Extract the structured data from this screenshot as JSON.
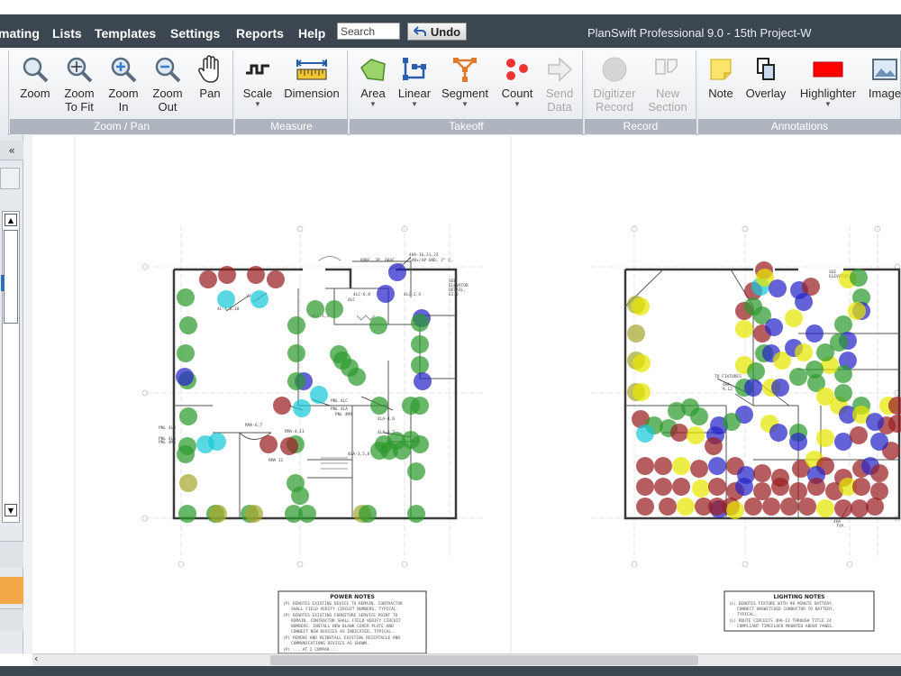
{
  "app_title": "PlanSwift Professional 9.0 - 15th Project-W",
  "menu": [
    "mating",
    "Lists",
    "Templates",
    "Settings",
    "Reports",
    "Help"
  ],
  "search": {
    "placeholder": "Search"
  },
  "undo_label": "Undo",
  "ribbon": {
    "groups": [
      "Zoom / Pan",
      "Measure",
      "Takeoff",
      "Record",
      "Annotations"
    ],
    "tools": {
      "zoom": [
        "Zoom",
        ""
      ],
      "zoom_to_fit": [
        "Zoom",
        "To Fit"
      ],
      "zoom_in": [
        "Zoom",
        "In"
      ],
      "zoom_out": [
        "Zoom",
        "Out"
      ],
      "pan": [
        "Pan",
        ""
      ],
      "scale": [
        "Scale",
        ""
      ],
      "dimension": [
        "Dimension",
        ""
      ],
      "area": [
        "Area",
        ""
      ],
      "linear": [
        "Linear",
        ""
      ],
      "segment": [
        "Segment",
        ""
      ],
      "count": [
        "Count",
        ""
      ],
      "send_data": [
        "Send",
        "Data"
      ],
      "digitizer_record": [
        "Digitizer",
        "Record"
      ],
      "new_section": [
        "New",
        "Section"
      ],
      "note": [
        "Note",
        ""
      ],
      "overlay": [
        "Overlay",
        ""
      ],
      "highlighter": [
        "Highlighter",
        ""
      ],
      "image": [
        "Image",
        ""
      ]
    }
  },
  "left_panel": {
    "collapse_glyph": "«"
  },
  "sheets": {
    "left_notes_title": "POWER NOTES",
    "right_notes_title": "LIGHTING NOTES"
  },
  "colors": {
    "menubar": "#3c4651",
    "green_count": "#2e9a2e",
    "red_count": "#9a1f22",
    "blue_count": "#2727c8",
    "yellow_count": "#e6e600",
    "cyan_count": "#19c7d8",
    "olive_count": "#a8a830"
  }
}
